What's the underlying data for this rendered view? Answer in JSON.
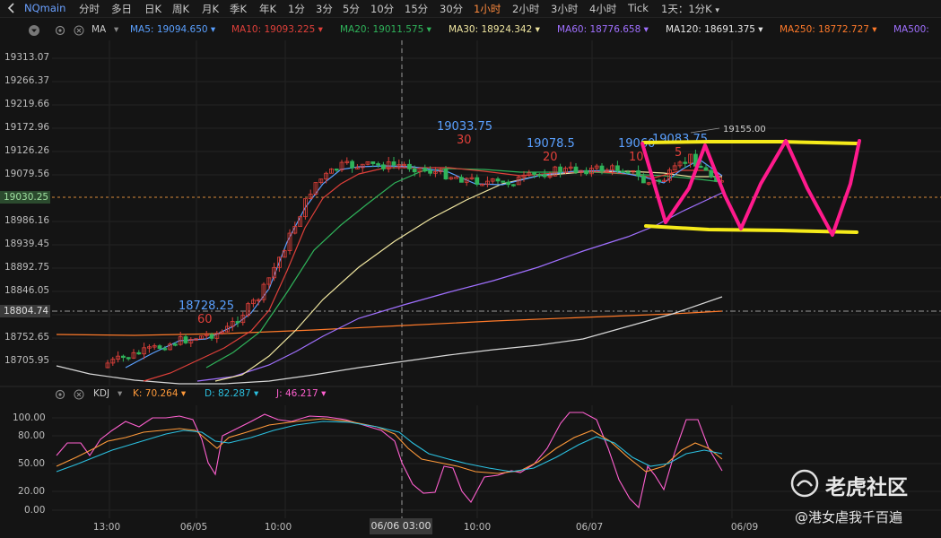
{
  "toolbar": {
    "symbol": "NQmain",
    "periods": [
      "分时",
      "多日",
      "日K",
      "周K",
      "月K",
      "季K",
      "年K",
      "1分",
      "3分",
      "5分",
      "10分",
      "15分",
      "30分",
      "1小时",
      "2小时",
      "3小时",
      "4小时",
      "Tick"
    ],
    "active_period": "1小时",
    "range_selector": "1天：1分K",
    "active_color": "#ff8a3d"
  },
  "ma_legend": {
    "label": "MA",
    "items": [
      {
        "label": "MA5:",
        "value": "19094.650",
        "color": "#5aa0ff"
      },
      {
        "label": "MA10:",
        "value": "19093.225",
        "color": "#e0403a"
      },
      {
        "label": "MA20:",
        "value": "19011.575",
        "color": "#2fb35a"
      },
      {
        "label": "MA30:",
        "value": "18924.342",
        "color": "#f0e6a0"
      },
      {
        "label": "MA60:",
        "value": "18776.658",
        "color": "#a070ff"
      },
      {
        "label": "MA120:",
        "value": "18691.375",
        "color": "#e6e6e6"
      },
      {
        "label": "MA250:",
        "value": "18772.727",
        "color": "#ff7a2a"
      },
      {
        "label": "MA500:",
        "value": "",
        "color": "#a070ff"
      }
    ]
  },
  "kdj_legend": {
    "label": "KDJ",
    "items": [
      {
        "label": "K:",
        "value": "70.264",
        "color": "#ff9a3a"
      },
      {
        "label": "D:",
        "value": "82.287",
        "color": "#2bc0e0"
      },
      {
        "label": "J:",
        "value": "46.217",
        "color": "#ff60d0"
      }
    ]
  },
  "price_axis": [
    "19313.07",
    "19266.37",
    "19219.66",
    "19172.96",
    "19126.26",
    "19079.56",
    "19030.25",
    "18986.16",
    "18939.45",
    "18892.75",
    "18846.05",
    "18804.74",
    "18752.65",
    "18705.95"
  ],
  "current_price": "19030.25",
  "crosshair_price": "18804.74",
  "kdj_axis": [
    "100.00",
    "80.00",
    "50.00",
    "20.00",
    "0.00"
  ],
  "time_axis": [
    "13:00",
    "06/05",
    "10:00",
    "06/06 03:00",
    "10:00",
    "06/07",
    "06/09"
  ],
  "crosshair_time": "06/06 03:00",
  "annotations": {
    "peak_a": {
      "price": "18728.25",
      "count": "60"
    },
    "peak_b": {
      "price": "19033.75",
      "count": "30"
    },
    "peak_c": {
      "price": "19078.5",
      "count": "20"
    },
    "peak_d": {
      "price": "19060",
      "count": "10"
    },
    "peak_e": {
      "price": "19083.75",
      "count": "5"
    },
    "high_label": "19155.00"
  },
  "watermark": {
    "brand": "老虎社区",
    "author": "@港女虐我千百遍"
  }
}
